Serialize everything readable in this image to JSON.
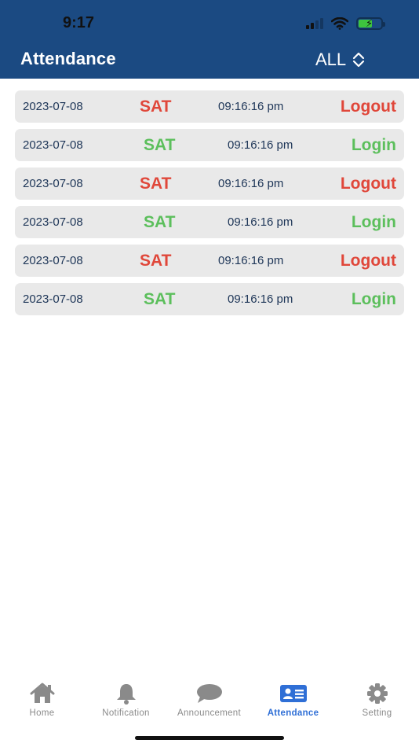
{
  "status_bar": {
    "time": "9:17"
  },
  "header": {
    "title": "Attendance",
    "filter_value": "ALL"
  },
  "records": [
    {
      "date": "2023-07-08",
      "day": "SAT",
      "time": "09:16:16 pm",
      "status": "Logout"
    },
    {
      "date": "2023-07-08",
      "day": "SAT",
      "time": "09:16:16 pm",
      "status": "Login"
    },
    {
      "date": "2023-07-08",
      "day": "SAT",
      "time": "09:16:16 pm",
      "status": "Logout"
    },
    {
      "date": "2023-07-08",
      "day": "SAT",
      "time": "09:16:16 pm",
      "status": "Login"
    },
    {
      "date": "2023-07-08",
      "day": "SAT",
      "time": "09:16:16 pm",
      "status": "Logout"
    },
    {
      "date": "2023-07-08",
      "day": "SAT",
      "time": "09:16:16 pm",
      "status": "Login"
    }
  ],
  "tabs": [
    {
      "label": "Home",
      "icon": "home-icon"
    },
    {
      "label": "Notification",
      "icon": "bell-icon"
    },
    {
      "label": "Announcement",
      "icon": "chat-bubble-icon"
    },
    {
      "label": "Attendance",
      "icon": "id-card-icon",
      "active": true
    },
    {
      "label": "Setting",
      "icon": "gear-icon"
    }
  ],
  "colors": {
    "header_bg": "#1b4a82",
    "logout": "#e0473a",
    "login": "#5cbf5c",
    "active_tab": "#2f6fd6",
    "inactive_tab": "#8a8a8a"
  }
}
